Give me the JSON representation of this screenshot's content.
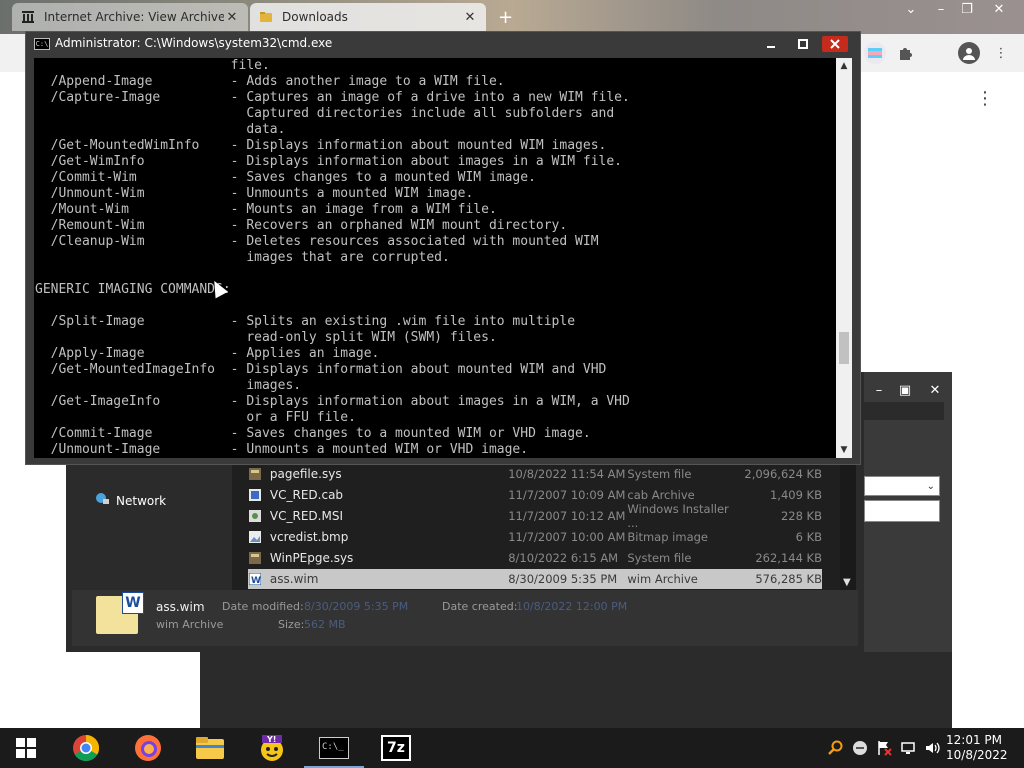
{
  "browser": {
    "tabs": [
      {
        "label": "Internet Archive: View Archive",
        "icon": "archive-icon"
      },
      {
        "label": "Downloads",
        "icon": "download-icon"
      }
    ],
    "new_tab": "+",
    "menu": "⋮"
  },
  "cmd": {
    "title": "Administrator: C:\\Windows\\system32\\cmd.exe",
    "icon_text": "C:\\",
    "lines": [
      "                         file.",
      "  /Append-Image          - Adds another image to a WIM file.",
      "  /Capture-Image         - Captures an image of a drive into a new WIM file.",
      "                           Captured directories include all subfolders and",
      "                           data.",
      "  /Get-MountedWimInfo    - Displays information about mounted WIM images.",
      "  /Get-WimInfo           - Displays information about images in a WIM file.",
      "  /Commit-Wim            - Saves changes to a mounted WIM image.",
      "  /Unmount-Wim           - Unmounts a mounted WIM image.",
      "  /Mount-Wim             - Mounts an image from a WIM file.",
      "  /Remount-Wim           - Recovers an orphaned WIM mount directory.",
      "  /Cleanup-Wim           - Deletes resources associated with mounted WIM",
      "                           images that are corrupted.",
      "",
      "GENERIC IMAGING COMMANDS:",
      "",
      "  /Split-Image           - Splits an existing .wim file into multiple",
      "                           read-only split WIM (SWM) files.",
      "  /Apply-Image           - Applies an image.",
      "  /Get-MountedImageInfo  - Displays information about mounted WIM and VHD",
      "                           images.",
      "  /Get-ImageInfo         - Displays information about images in a WIM, a VHD",
      "                           or a FFU file.",
      "  /Commit-Image          - Saves changes to a mounted WIM or VHD image.",
      "  /Unmount-Image         - Unmounts a mounted WIM or VHD image."
    ]
  },
  "explorer": {
    "network_label": "Network",
    "files": [
      {
        "name": "pagefile.sys",
        "date": "10/8/2022 11:54 AM",
        "type": "System file",
        "size": "2,096,624 KB",
        "icon": "system-file-icon"
      },
      {
        "name": "VC_RED.cab",
        "date": "11/7/2007 10:09 AM",
        "type": "cab Archive",
        "size": "1,409 KB",
        "icon": "archive-file-icon"
      },
      {
        "name": "VC_RED.MSI",
        "date": "11/7/2007 10:12 AM",
        "type": "Windows Installer ...",
        "size": "228 KB",
        "icon": "installer-file-icon"
      },
      {
        "name": "vcredist.bmp",
        "date": "11/7/2007 10:00 AM",
        "type": "Bitmap image",
        "size": "6 KB",
        "icon": "image-file-icon"
      },
      {
        "name": "WinPEpge.sys",
        "date": "8/10/2022 6:15 AM",
        "type": "System file",
        "size": "262,144 KB",
        "icon": "system-file-icon"
      },
      {
        "name": "ass.wim",
        "date": "8/30/2009 5:35 PM",
        "type": "wim Archive",
        "size": "576,285 KB",
        "icon": "wim-file-icon",
        "selected": true
      }
    ],
    "details": {
      "name": "ass.wim",
      "type": "wim Archive",
      "badge": "W",
      "date_modified_label": "Date modified:",
      "date_modified_value": "8/30/2009 5:35 PM",
      "date_created_label": "Date created:",
      "date_created_value": "10/8/2022 12:00 PM",
      "size_label": "Size:",
      "size_value": "562 MB"
    }
  },
  "taskbar": {
    "apps": [
      "windows-start-icon",
      "chrome-icon",
      "firefox-icon",
      "file-explorer-icon",
      "yahoo-messenger-icon",
      "cmd-icon",
      "7zip-icon"
    ],
    "cmd_icon_text": "C:\\_",
    "sevenzip_text": "7z",
    "clock_time": "12:01 PM",
    "clock_date": "10/8/2022"
  },
  "colors": {
    "close_red": "#c42b1c",
    "taskbar": "#1b1b1b",
    "console_text": "#c0c0c0"
  }
}
